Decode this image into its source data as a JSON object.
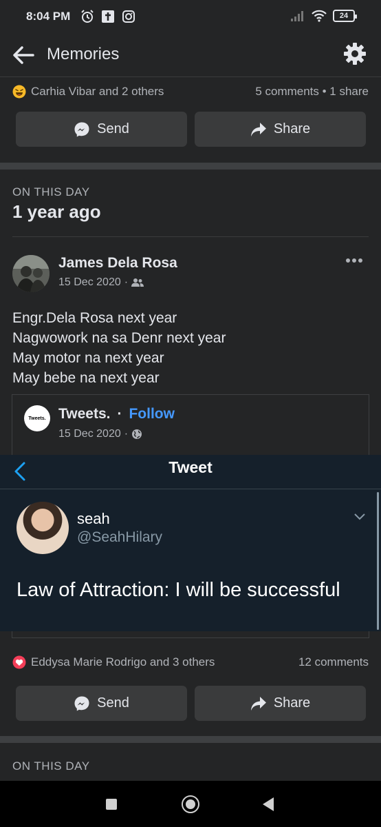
{
  "status_bar": {
    "time": "8:04 PM",
    "battery": "24"
  },
  "header": {
    "title": "Memories"
  },
  "top_post": {
    "reactions_text": "Carhia Vibar and 2 others",
    "comments_shares": "5 comments • 1 share",
    "send_label": "Send",
    "share_label": "Share"
  },
  "memory": {
    "section_label": "ON THIS DAY",
    "time_ago": "1 year ago",
    "author": "James Dela Rosa",
    "date": "15 Dec 2020",
    "text_lines": [
      "Engr.Dela Rosa next year",
      "Nagwowork na sa Denr next year",
      "May motor na next year",
      "May bebe na next year"
    ],
    "shared": {
      "page_name": "Tweets.",
      "separator": "·",
      "follow_label": "Follow",
      "date": "15 Dec 2020",
      "logo_text": "Tweets.",
      "tweet": {
        "title": "Tweet",
        "name": "seah",
        "handle": "@SeahHilary",
        "body": "Law of Attraction: I will be successful"
      }
    },
    "reactions_text": "Eddysa Marie Rodrigo and 3 others",
    "comments": "12 comments",
    "send_label": "Send",
    "share_label": "Share"
  },
  "next_memory": {
    "section_label": "ON THIS DAY"
  },
  "icons": {
    "back": "arrow-left-icon",
    "settings": "gear-icon",
    "messenger": "messenger-icon",
    "share": "share-arrow-icon",
    "more": "more-dots-icon",
    "friends": "friends-icon",
    "public": "globe-icon"
  },
  "colors": {
    "background": "#242526",
    "button": "#3a3b3c",
    "follow_link": "#4599ff",
    "tweet_bg": "#15202b"
  }
}
